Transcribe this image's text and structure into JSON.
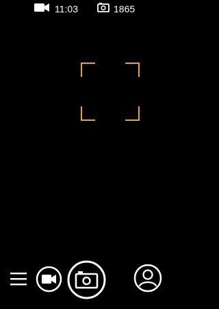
{
  "status_bar": {
    "video_icon": "video-camera-icon",
    "video_time": "11:03",
    "photo_icon": "photo-camera-icon",
    "photo_count": "1865"
  },
  "viewfinder": {
    "focus_color": "#e8a33a"
  },
  "controls": {
    "menu_icon": "hamburger-menu-icon",
    "video_mode_icon": "video-camera-icon",
    "shutter_icon": "photo-camera-icon",
    "profile_icon": "user-icon"
  }
}
